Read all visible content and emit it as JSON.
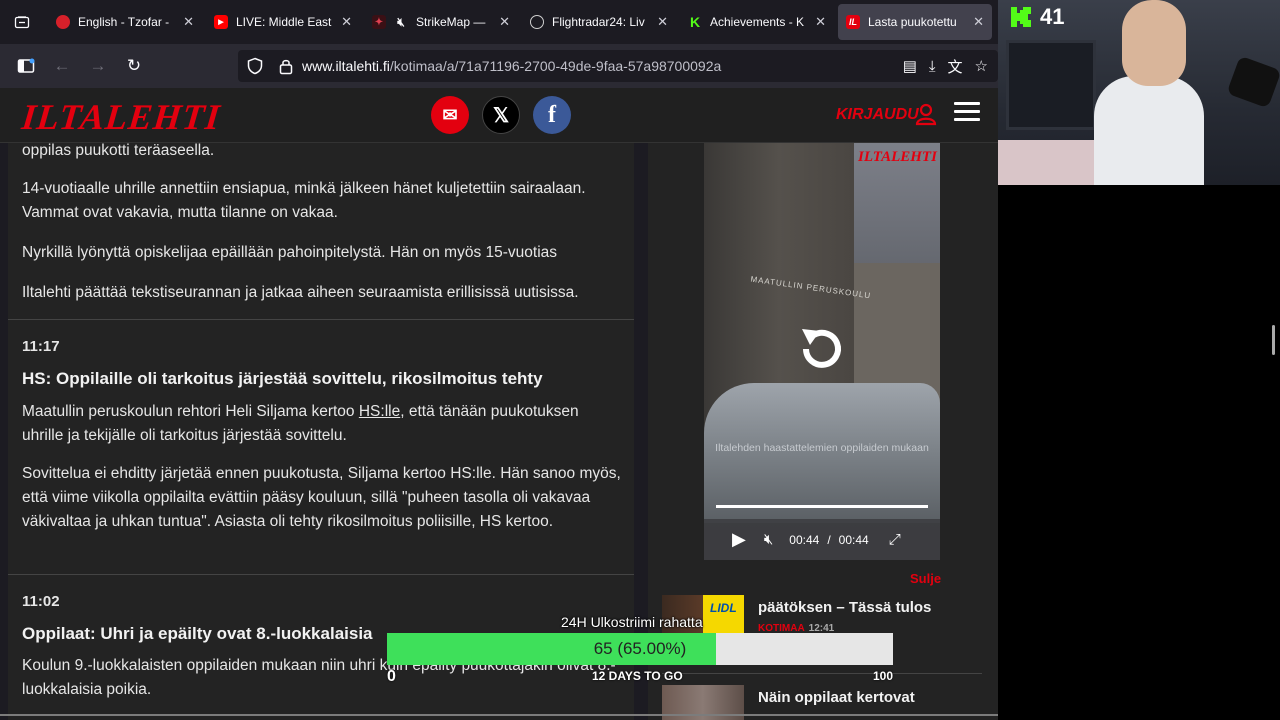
{
  "browser": {
    "tabs": [
      {
        "title": "English - Tzofar -",
        "favicon": "red-circle",
        "color": "#d6202a"
      },
      {
        "title": "LIVE: Middle East",
        "favicon": "youtube",
        "color": "#ff0000"
      },
      {
        "title": "StrikeMap —",
        "favicon": "muted-speaker",
        "color": "#b0202a"
      },
      {
        "title": "Flightradar24: Liv",
        "favicon": "radar",
        "color": "#cfcfcf"
      },
      {
        "title": "Achievements - K",
        "favicon": "kick",
        "color": "#53fc18"
      },
      {
        "title": "Lasta puukotettu",
        "favicon": "iltalehti",
        "color": "#e3000f",
        "active": true
      }
    ],
    "url_domain": "www.iltalehti.fi",
    "url_path": "/kotimaa/a/71a71196-2700-49de-9faa-57a98700092a"
  },
  "site": {
    "logo": "ILTALEHTI",
    "login_label": "KIRJAUDU",
    "brand_color": "#e3000f"
  },
  "article": {
    "top_fragment": "oppilas puukotti teräaseella.",
    "p1": "14-vuotiaalle uhrille annettiin ensiapua, minkä jälkeen hänet kuljetettiin sairaalaan. Vammat ovat vakavia, mutta tilanne on vakaa.",
    "p2": "Nyrkillä lyönyttä opiskelijaa epäillään pahoinpitelystä. Hän on myös 15-vuotias",
    "p3": "Iltalehti päättää tekstiseurannan ja jatkaa aiheen seuraamista erillisissä uutisissa.",
    "entries": [
      {
        "time": "11:17",
        "heading": "HS: Oppilaille oli tarkoitus järjestää sovittelu, rikosilmoitus tehty",
        "p1_before": "Maatullin peruskoulun rehtori Heli Siljama kertoo ",
        "p1_link": "HS:lle",
        "p1_after": ", että tänään puukotuksen uhrille ja tekijälle oli tarkoitus järjestää sovittelu.",
        "p2": "Sovittelua ei ehditty järjetää ennen puukotusta, Siljama kertoo HS:lle. Hän sanoo myös, että viime viikolla oppilailta evättiin pääsy kouluun, sillä \"puheen tasolla oli vakavaa väkivaltaa ja uhkan tuntua\". Asiasta oli tehty rikosilmoitus poliisille, HS kertoo."
      },
      {
        "time": "11:02",
        "heading": "Oppilaat: Uhri ja epäilty ovat 8.-luokkalaisia",
        "p1": "Koulun 9.-luokkalaisten oppilaiden mukaan niin uhri kuin epäilty puukottajakin olivat 8.-luokkalaisia poikia."
      }
    ]
  },
  "video": {
    "watermark": "ILTALEHTI",
    "caption": "Iltalehden haastattelemien oppilaiden mukaan",
    "sign": "MAATULLIN PERUSKOULU",
    "current_time": "00:44",
    "separator": "/",
    "duration": "00:44",
    "progress": 1.0
  },
  "sidebar": {
    "close_label": "Sulje",
    "items": [
      {
        "title": "päätöksen – Tässä tulos",
        "category": "KOTIMAA",
        "time": "12:41"
      },
      {
        "title": "Näin oppilaat kertovat",
        "category": "",
        "time": ""
      }
    ]
  },
  "stream": {
    "kick_count": "41",
    "goal_title": "24H Ulkostriimi rahatta",
    "goal_text": "65 (65.00%)",
    "goal_progress": 0.65,
    "goal_min": "0",
    "goal_max": "100",
    "goal_days": "12 DAYS TO GO"
  }
}
